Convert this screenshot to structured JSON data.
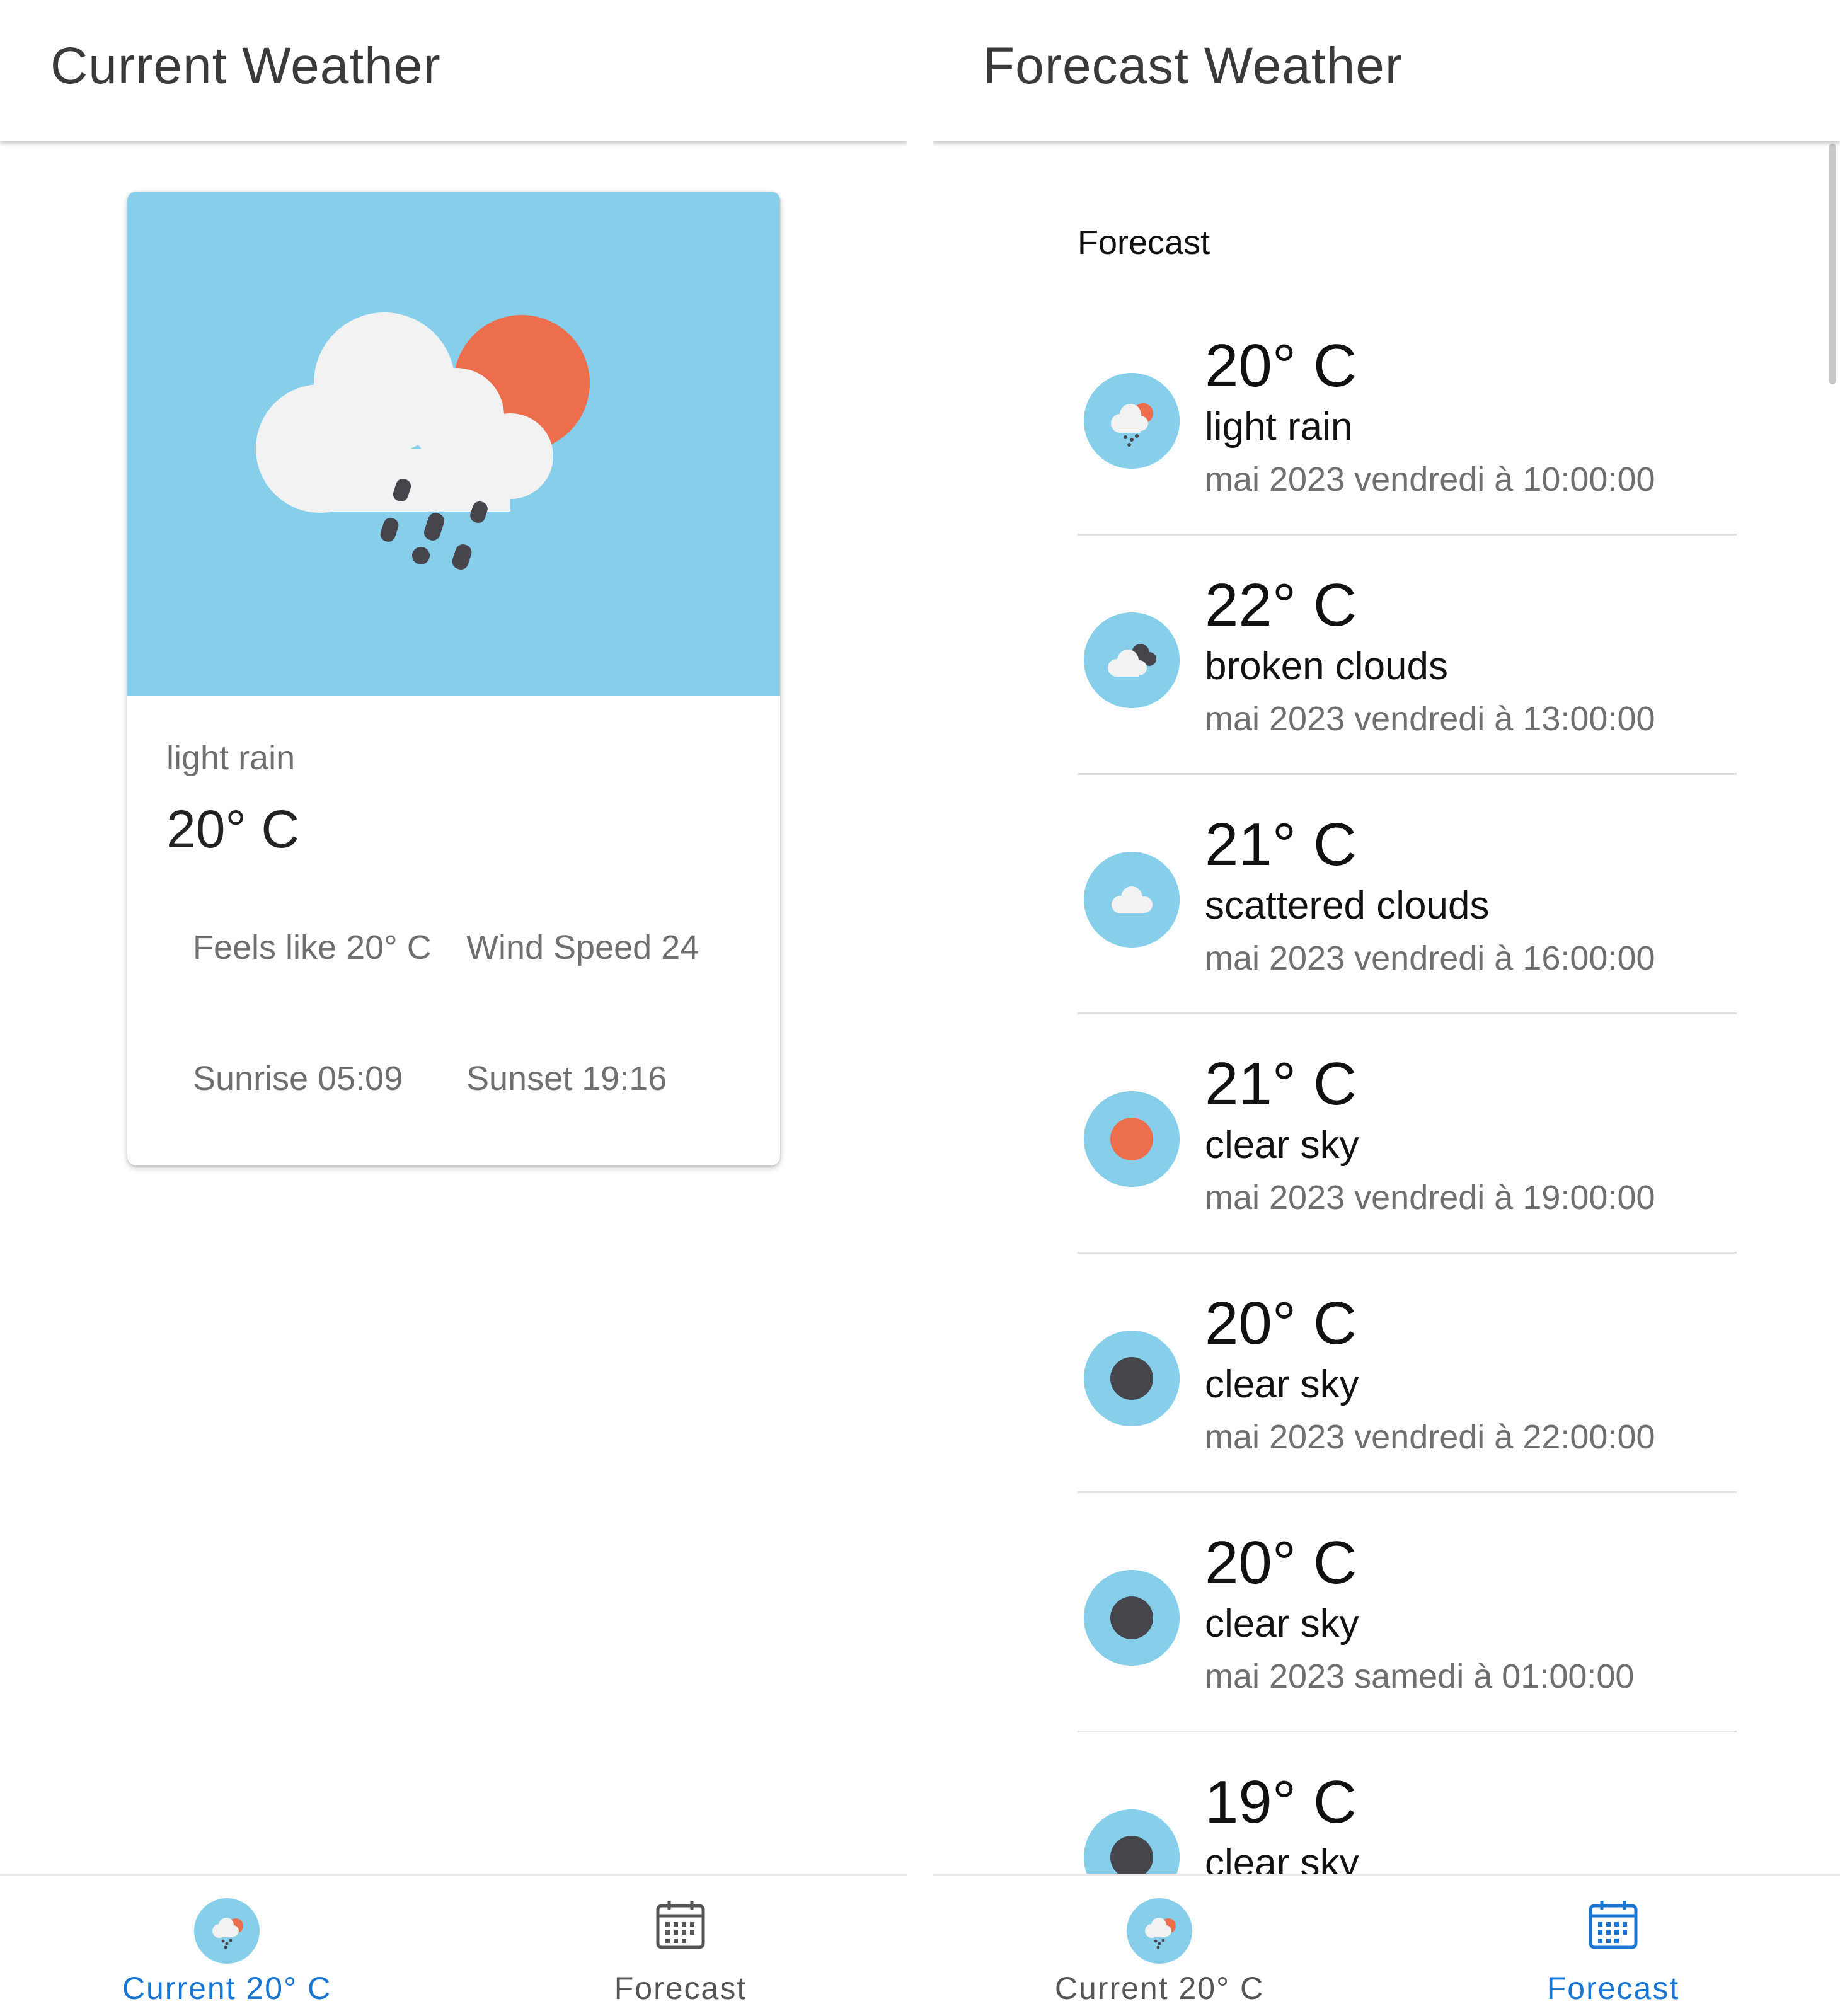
{
  "current_screen": {
    "header_title": "Current Weather",
    "card": {
      "description": "light rain",
      "temperature": "20° C",
      "feels_like": "Feels like 20° C",
      "wind_speed": "Wind Speed 24",
      "sunrise": "Sunrise 05:09",
      "sunset": "Sunset 19:16",
      "icon": "light-rain-icon"
    },
    "bottom_nav": {
      "current_label": "Current 20° C",
      "forecast_label": "Forecast",
      "active": "current"
    }
  },
  "forecast_screen": {
    "header_title": "Forecast Weather",
    "section_heading": "Forecast",
    "items": [
      {
        "temp": "20° C",
        "desc": "light rain",
        "date": "mai 2023 vendredi à 10:00:00",
        "icon": "light-rain-icon"
      },
      {
        "temp": "22° C",
        "desc": "broken clouds",
        "date": "mai 2023 vendredi à 13:00:00",
        "icon": "broken-clouds-icon"
      },
      {
        "temp": "21° C",
        "desc": "scattered clouds",
        "date": "mai 2023 vendredi à 16:00:00",
        "icon": "scattered-clouds-icon"
      },
      {
        "temp": "21° C",
        "desc": "clear sky",
        "date": "mai 2023 vendredi à 19:00:00",
        "icon": "clear-sky-day-icon"
      },
      {
        "temp": "20° C",
        "desc": "clear sky",
        "date": "mai 2023 vendredi à 22:00:00",
        "icon": "clear-sky-night-icon"
      },
      {
        "temp": "20° C",
        "desc": "clear sky",
        "date": "mai 2023 samedi à 01:00:00",
        "icon": "clear-sky-night-icon"
      },
      {
        "temp": "19° C",
        "desc": "clear sky",
        "date": "",
        "icon": "clear-sky-night-icon"
      }
    ],
    "bottom_nav": {
      "current_label": "Current 20° C",
      "forecast_label": "Forecast",
      "active": "forecast"
    }
  },
  "colors": {
    "sky": "#87ceeb",
    "sun": "#ec6e4c",
    "cloud": "#f2f2f2",
    "dark": "#45454b",
    "accent": "#1976d2"
  }
}
